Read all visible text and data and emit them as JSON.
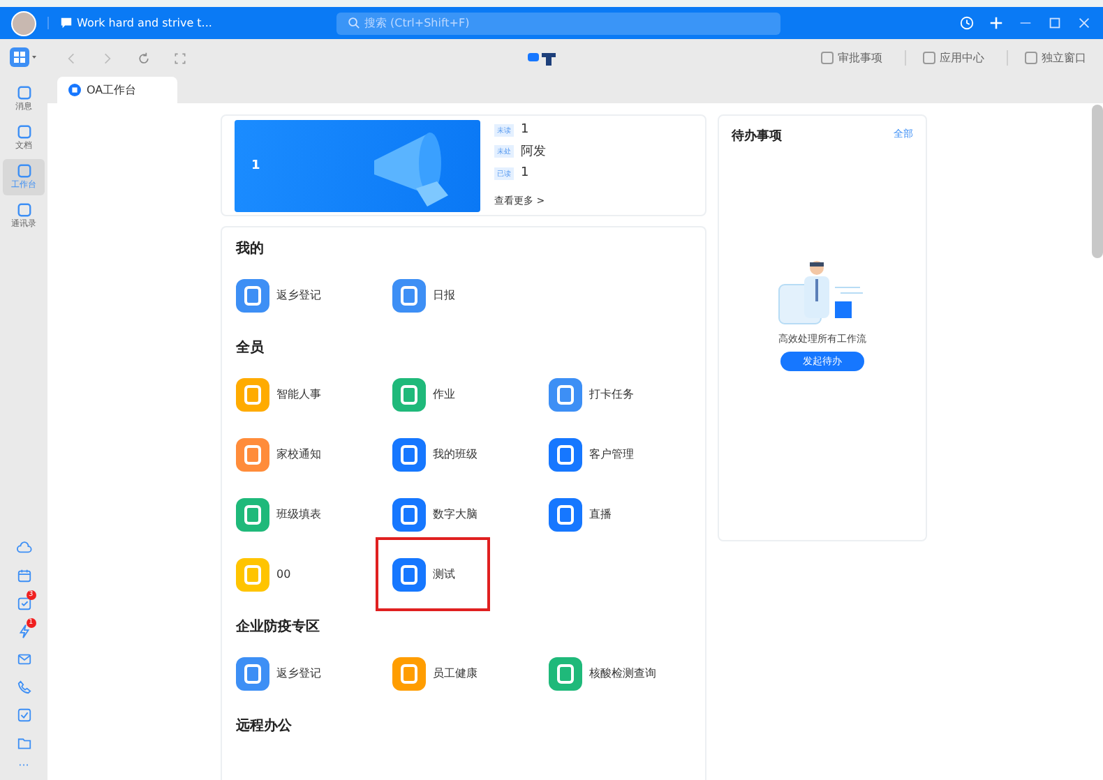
{
  "title_bar": {
    "chat_title": "Work hard and strive t...",
    "search_placeholder": "搜索 (Ctrl+Shift+F)"
  },
  "sidebar": {
    "items": [
      {
        "label": "消息",
        "selected": false
      },
      {
        "label": "文档",
        "selected": false
      },
      {
        "label": "工作台",
        "selected": true
      },
      {
        "label": "通讯录",
        "selected": false
      }
    ],
    "bottom_icons": [
      {
        "kind": "cloud"
      },
      {
        "kind": "calendar"
      },
      {
        "kind": "tasks",
        "badge": "3"
      },
      {
        "kind": "bolt",
        "badge": "1"
      },
      {
        "kind": "mail"
      },
      {
        "kind": "phone"
      },
      {
        "kind": "check"
      },
      {
        "kind": "folder"
      }
    ],
    "more": "···"
  },
  "toolbar": {
    "links": [
      "审批事项",
      "应用中心",
      "独立窗口"
    ]
  },
  "tabs": [
    {
      "label": "OA工作台",
      "selected": true
    }
  ],
  "banner": {
    "number": "1",
    "notices": [
      {
        "tag": "未读",
        "text": "1"
      },
      {
        "tag": "未处",
        "text": "阿发"
      },
      {
        "tag": "已读",
        "text": "1"
      }
    ],
    "more": "查看更多 >"
  },
  "sections": [
    {
      "title": "我的",
      "items": [
        {
          "label": "返乡登记",
          "color": "#3d8ff5",
          "highlighted": false
        },
        {
          "label": "日报",
          "color": "#3d8ff5",
          "highlighted": false
        }
      ]
    },
    {
      "title": "全员",
      "items": [
        {
          "label": "智能人事",
          "color": "#ffab00",
          "highlighted": false
        },
        {
          "label": "作业",
          "color": "#1fb97a",
          "highlighted": false
        },
        {
          "label": "打卡任务",
          "color": "#3d8ff5",
          "highlighted": false
        },
        {
          "label": "家校通知",
          "color": "#ff8c3a",
          "highlighted": false
        },
        {
          "label": "我的班级",
          "color": "#1677ff",
          "highlighted": false
        },
        {
          "label": "客户管理",
          "color": "#1677ff",
          "highlighted": false
        },
        {
          "label": "班级填表",
          "color": "#1fb97a",
          "highlighted": false
        },
        {
          "label": "数字大脑",
          "color": "#1677ff",
          "highlighted": false
        },
        {
          "label": "直播",
          "color": "#1677ff",
          "highlighted": false
        },
        {
          "label": "00",
          "color": "#ffc400",
          "highlighted": false
        },
        {
          "label": "测试",
          "color": "#1677ff",
          "highlighted": true
        }
      ]
    },
    {
      "title": "企业防疫专区",
      "items": [
        {
          "label": "返乡登记",
          "color": "#3d8ff5",
          "highlighted": false
        },
        {
          "label": "员工健康",
          "color": "#ff9d00",
          "highlighted": false
        },
        {
          "label": "核酸检测查询",
          "color": "#1fb97a",
          "highlighted": false
        }
      ]
    },
    {
      "title": "远程办公"
    }
  ],
  "todo": {
    "title": "待办事项",
    "all_link": "全部",
    "caption": "高效处理所有工作流",
    "button": "发起待办"
  }
}
